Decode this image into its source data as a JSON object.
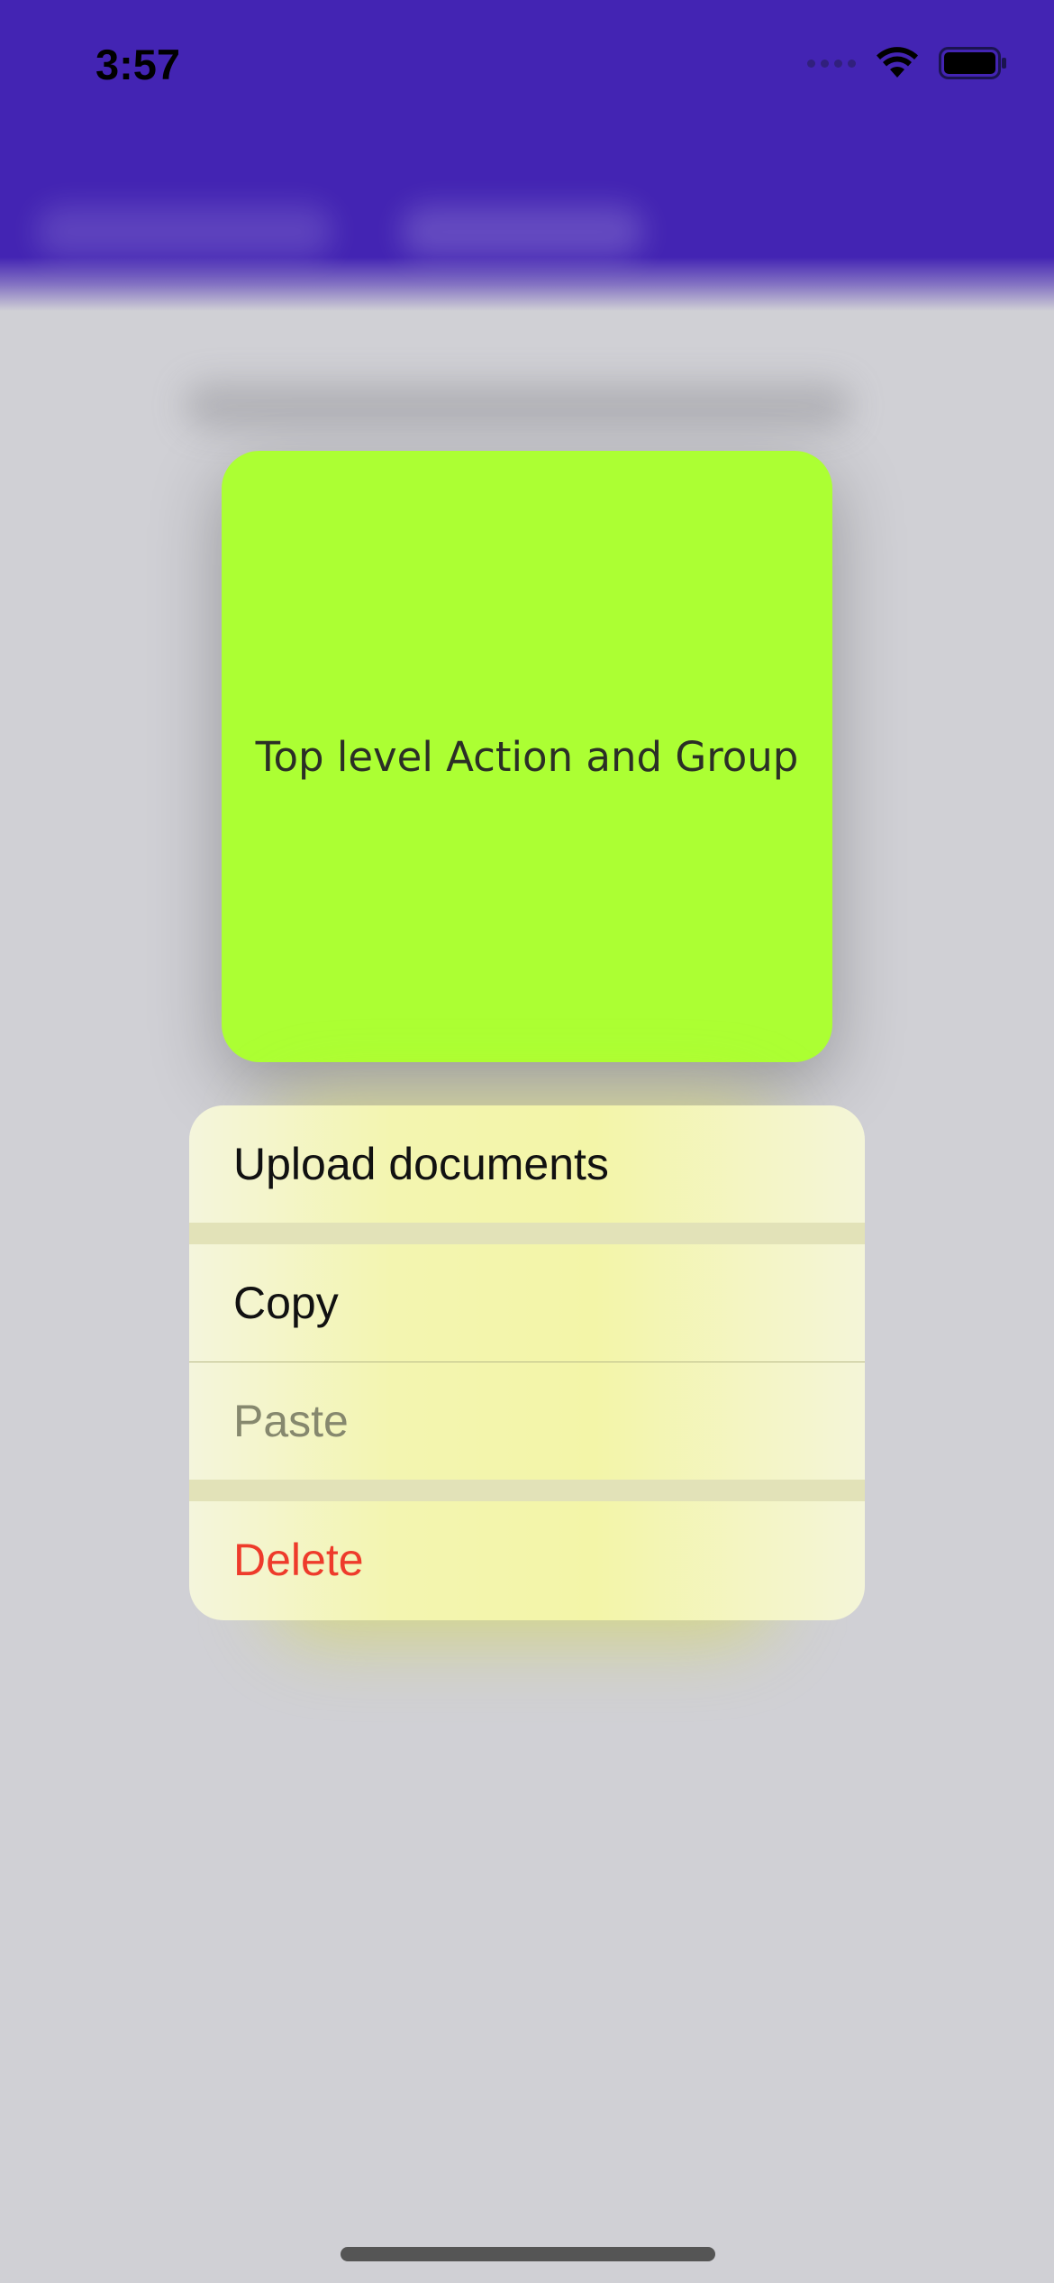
{
  "status_bar": {
    "time": "3:57"
  },
  "colors": {
    "app_bar": "#4324b3",
    "backdrop": "#d0d0d5",
    "preview_card": "#acff33",
    "menu_background": "#f3f5b0",
    "destructive": "#ee3b2b"
  },
  "preview": {
    "label": "Top level Action and Group"
  },
  "context_menu": {
    "items": [
      {
        "label": "Upload documents",
        "state": "enabled"
      },
      {
        "label": "Copy",
        "state": "enabled"
      },
      {
        "label": "Paste",
        "state": "disabled"
      },
      {
        "label": "Delete",
        "state": "destructive"
      }
    ]
  },
  "icons": {
    "signal": "cellular-signal-icon",
    "wifi": "wifi-icon",
    "battery": "battery-icon"
  }
}
